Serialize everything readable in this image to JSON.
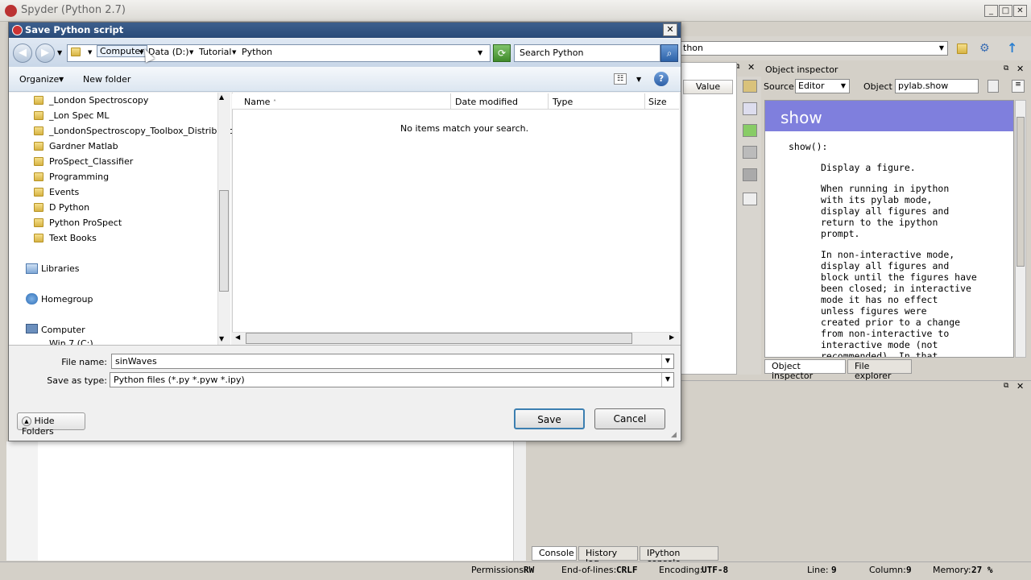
{
  "app": {
    "title": "Spyder (Python 2.7)",
    "working_dir_partial": "thon"
  },
  "variable_explorer": {
    "column_value": "Value"
  },
  "object_inspector": {
    "title": "Object inspector",
    "source_label": "Source",
    "source_value": "Editor",
    "object_label": "Object",
    "object_value": "pylab.show",
    "heading": "show",
    "signature": "show():",
    "paragraphs": [
      [
        "Display a figure."
      ],
      [
        "When running in ipython",
        "with its pylab mode,",
        "display all figures and",
        "return to the ipython",
        "prompt."
      ],
      [
        "In non-interactive mode,",
        "display all figures and",
        "block until the figures have",
        "been closed; in interactive",
        "mode it has no effect",
        "unless figures were",
        "created prior to a change",
        "from non-interactive to",
        "interactive mode (not",
        "recommended). In that"
      ]
    ],
    "tabs": [
      "Object inspector",
      "File explorer"
    ]
  },
  "console": {
    "tabs": [
      "Console",
      "History log",
      "IPython console"
    ]
  },
  "statusbar": {
    "permissions_label": "Permissions:",
    "permissions_value": "RW",
    "eol_label": "End-of-lines:",
    "eol_value": "CRLF",
    "encoding_label": "Encoding:",
    "encoding_value": "UTF-8",
    "line_label": "Line:",
    "line_value": "9",
    "column_label": "Column:",
    "column_value": "9",
    "memory_label": "Memory:",
    "memory_value": "27 %"
  },
  "dialog": {
    "title": "Save Python script",
    "breadcrumbs": [
      "Computer",
      "Data (D:)",
      "Tutorial",
      "Python"
    ],
    "search_placeholder": "Search Python",
    "organize": "Organize",
    "new_folder": "New folder",
    "nav_folders": [
      "_London Spectroscopy",
      "_Lon Spec ML",
      "_LondonSpectroscopy_Toolbox_Distribution",
      "Gardner Matlab",
      "ProSpect_Classifier",
      "Programming",
      "Events",
      "D Python",
      "Python ProSpect",
      "Text Books"
    ],
    "libraries": "Libraries",
    "homegroup": "Homegroup",
    "computer": "Computer",
    "drive_partial": "Win 7 (C:)",
    "columns": [
      "Name",
      "Date modified",
      "Type",
      "Size"
    ],
    "empty_message": "No items match your search.",
    "file_name_label": "File name:",
    "file_name_value": "sinWaves",
    "save_type_label": "Save as type:",
    "save_type_value": "Python files (*.py *.pyw *.ipy)",
    "hide_folders": "Hide Folders",
    "save": "Save",
    "cancel": "Cancel"
  }
}
